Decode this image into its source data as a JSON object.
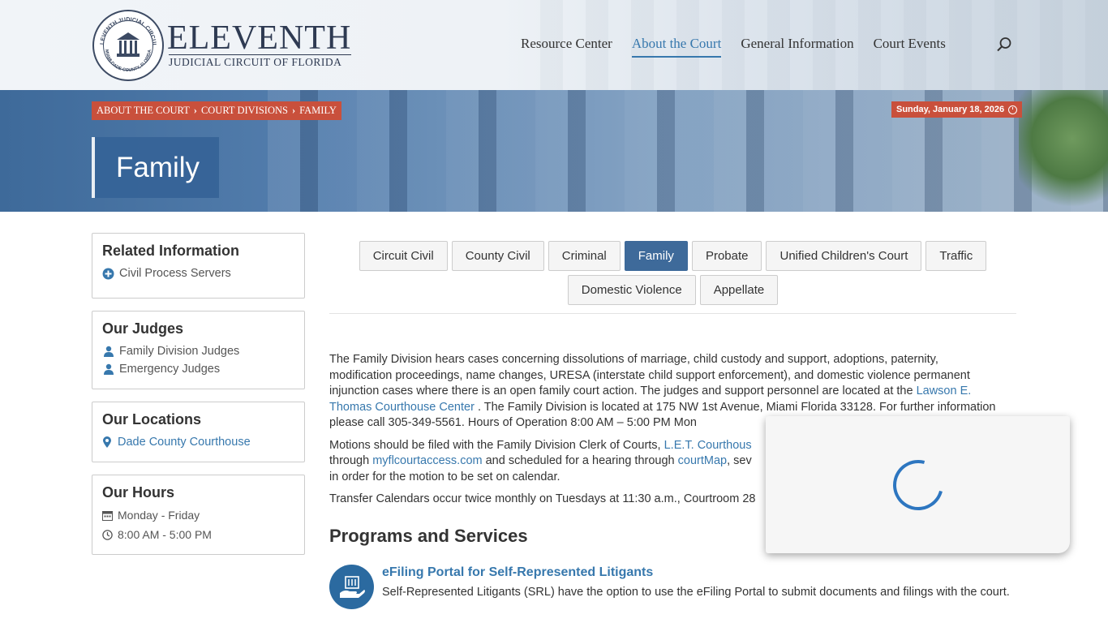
{
  "header": {
    "logo": {
      "title": "ELEVENTH",
      "subtitle": "JUDICIAL CIRCUIT OF FLORIDA",
      "seal_text_top": "ELEVENTH JUDICIAL CIRCUIT",
      "seal_text_bottom": "MIAMI-DADE COUNTY, FLORIDA"
    },
    "nav": [
      {
        "label": "Resource Center",
        "active": false
      },
      {
        "label": "About the Court",
        "active": true
      },
      {
        "label": "General Information",
        "active": false
      },
      {
        "label": "Court Events",
        "active": false
      }
    ],
    "search_icon": "search-icon"
  },
  "hero": {
    "breadcrumb": [
      "ABOUT THE COURT",
      "COURT DIVISIONS",
      "FAMILY"
    ],
    "date": "Sunday, January 18, 2026",
    "title": "Family"
  },
  "sidebar": {
    "related": {
      "heading": "Related Information",
      "items": [
        {
          "label": "Civil Process Servers",
          "icon": "plus-circle-icon"
        }
      ]
    },
    "judges": {
      "heading": "Our Judges",
      "items": [
        {
          "label": "Family Division Judges",
          "icon": "user-icon"
        },
        {
          "label": "Emergency Judges",
          "icon": "user-icon"
        }
      ]
    },
    "locations": {
      "heading": "Our Locations",
      "items": [
        {
          "label": "Dade County Courthouse",
          "icon": "map-marker-icon"
        }
      ]
    },
    "hours": {
      "heading": "Our Hours",
      "items": [
        {
          "label": "Monday - Friday",
          "icon": "calendar-icon"
        },
        {
          "label": "8:00 AM - 5:00 PM",
          "icon": "clock-icon"
        }
      ]
    }
  },
  "tabs": {
    "row1": [
      "Circuit Civil",
      "County Civil",
      "Criminal",
      "Family",
      "Probate",
      "Unified Children's Court",
      "Traffic"
    ],
    "row2": [
      "Domestic Violence",
      "Appellate"
    ],
    "active": "Family"
  },
  "content": {
    "p1_a": "The Family Division hears cases concerning dissolutions of marriage, child custody and support, adoptions, paternity, modification proceedings, name changes, URESA (interstate child support enforcement), and domestic violence permanent injunction cases where there is an open family court action. The judges and support personnel are located at the ",
    "p1_link": "Lawson E. Thomas Courthouse Center",
    "p1_b": " . The Family Division is located at 175 NW 1st Avenue, Miami Florida 33128. For further information please call 305-349-5561. Hours of Operation 8:00 AM – 5:00 PM Mon",
    "p2_a": "Motions should be filed with the Family Division Clerk of Courts, ",
    "p2_link1": "L.E.T. Courthous",
    "p2_b": " through ",
    "p2_link2": "myflcourtaccess.com",
    "p2_c": " and scheduled for a hearing through ",
    "p2_link3": "courtMap",
    "p2_d": ", sev",
    "p2_e": "in order for the motion to be set on calendar.",
    "p3": "Transfer Calendars occur twice monthly on Tuesdays at 11:30 a.m., Courtroom 28"
  },
  "programs": {
    "heading": "Programs and Services",
    "items": [
      {
        "title": "eFiling Portal for Self-Represented Litigants",
        "desc": "Self-Represented Litigants (SRL) have the option to use the eFiling Portal to submit documents and filings with the court.",
        "icon": "efiling-icon"
      }
    ]
  },
  "loader": {
    "icon": "loading-spinner-icon"
  },
  "colors": {
    "accent": "#3778ad",
    "breadcrumb_bg": "#c9503c",
    "active_tab": "#3e6a9a"
  }
}
